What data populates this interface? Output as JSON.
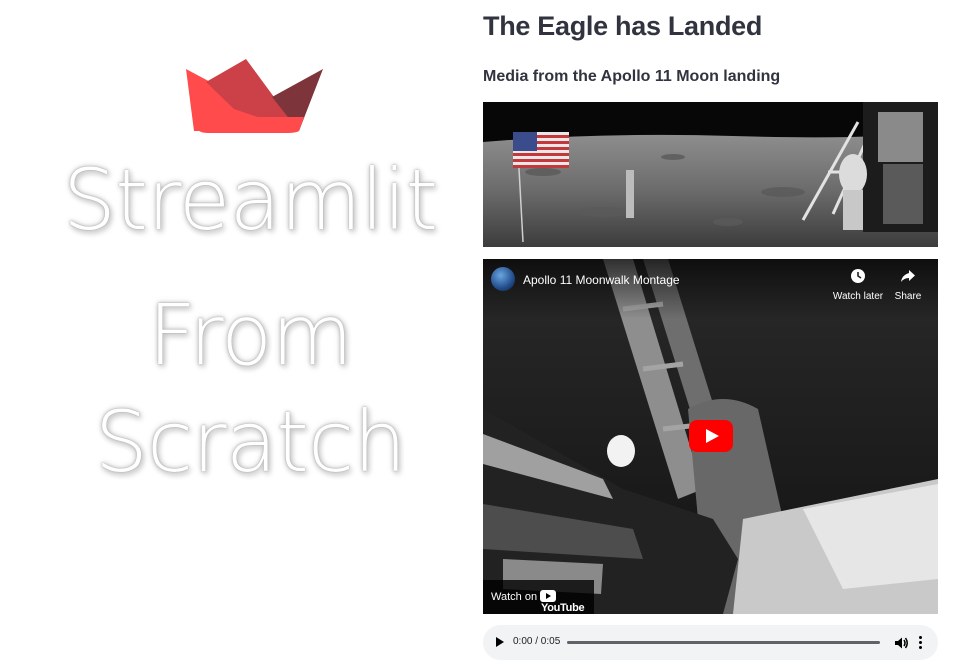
{
  "sidebar": {
    "title_lines": [
      "Streamlit",
      "From",
      "Scratch"
    ],
    "logo_icon": "streamlit-boat-logo",
    "logo_colors": [
      "#ff4b4b",
      "#d94a4a",
      "#7d353b"
    ]
  },
  "main": {
    "title": "The Eagle has Landed",
    "subtitle": "Media from the Apollo 11 Moon landing",
    "image_icon": "apollo-11-moon-landing-photo"
  },
  "video": {
    "title": "Apollo 11 Moonwalk Montage",
    "watch_later_label": "Watch later",
    "share_label": "Share",
    "watch_on_label": "Watch on",
    "brand_label": "YouTube",
    "play_icon": "play-icon",
    "accent": "#ff0000"
  },
  "audio": {
    "time": "0:00 / 0:05",
    "progress": 0,
    "play_icon": "play-icon",
    "volume_icon": "volume-icon",
    "more_icon": "more-vert-icon"
  }
}
